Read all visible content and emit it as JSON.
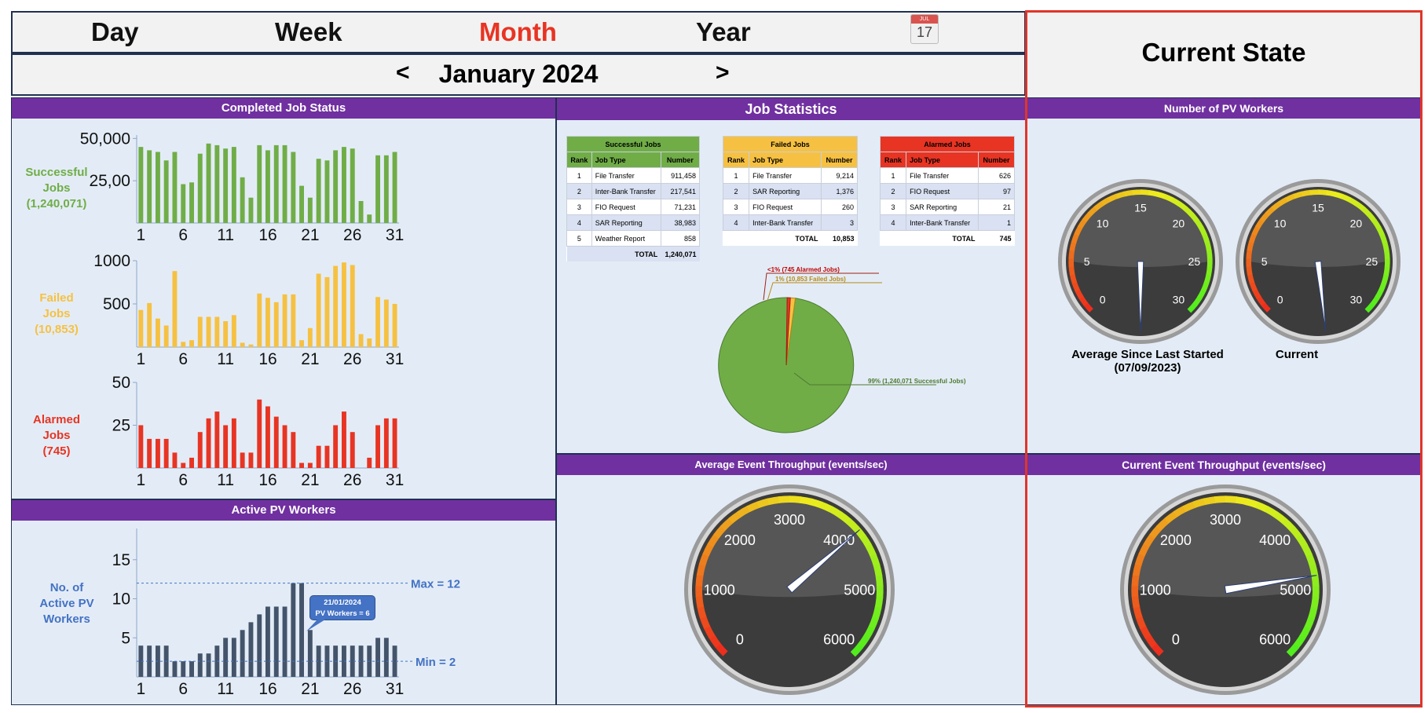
{
  "tabs": {
    "day": "Day",
    "week": "Week",
    "month": "Month",
    "year": "Year"
  },
  "calendar_icon": {
    "month": "JUL",
    "day": "17"
  },
  "period": {
    "prev": "<",
    "label": "January 2024",
    "next": ">"
  },
  "current_state": {
    "title": "Current State"
  },
  "completed": {
    "title": "Completed Job Status",
    "successful": {
      "l1": "Successful",
      "l2": "Jobs",
      "l3": "(1,240,071)"
    },
    "failed": {
      "l1": "Failed",
      "l2": "Jobs",
      "l3": "(10,853)"
    },
    "alarmed": {
      "l1": "Alarmed",
      "l2": "Jobs",
      "l3": "(745)"
    }
  },
  "active": {
    "title": "Active PV Workers",
    "ylabel": {
      "l1": "No. of",
      "l2": "Active PV",
      "l3": "Workers"
    },
    "max_label": "Max = 12",
    "min_label": "Min = 2",
    "tooltip": {
      "l1": "21/01/2024",
      "l2": "PV Workers = 6"
    }
  },
  "stats": {
    "title": "Job Statistics",
    "headers": {
      "rank": "Rank",
      "type": "Job Type",
      "number": "Number"
    },
    "successful": {
      "title": "Successful Jobs",
      "rows": [
        [
          "1",
          "File Transfer",
          "911,458"
        ],
        [
          "2",
          "Inter-Bank Transfer",
          "217,541"
        ],
        [
          "3",
          "FIO Request",
          "71,231"
        ],
        [
          "4",
          "SAR Reporting",
          "38,983"
        ],
        [
          "5",
          "Weather Report",
          "858"
        ]
      ],
      "total_label": "TOTAL",
      "total": "1,240,071"
    },
    "failed": {
      "title": "Failed Jobs",
      "rows": [
        [
          "1",
          "File Transfer",
          "9,214"
        ],
        [
          "2",
          "SAR Reporting",
          "1,376"
        ],
        [
          "3",
          "FIO Request",
          "260"
        ],
        [
          "4",
          "Inter-Bank Transfer",
          "3"
        ]
      ],
      "total_label": "TOTAL",
      "total": "10,853"
    },
    "alarmed": {
      "title": "Alarmed Jobs",
      "rows": [
        [
          "1",
          "File Transfer",
          "626"
        ],
        [
          "2",
          "FIO Request",
          "97"
        ],
        [
          "3",
          "SAR Reporting",
          "21"
        ],
        [
          "4",
          "Inter-Bank Transfer",
          "1"
        ]
      ],
      "total_label": "TOTAL",
      "total": "745"
    },
    "pie": {
      "alarmed": "<1% (745 Alarmed Jobs)",
      "failed": "1% (10,853 Failed Jobs)",
      "successful": "99% (1,240,071 Successful Jobs)"
    }
  },
  "workers": {
    "title": "Number of PV Workers",
    "avg_l1": "Average Since Last Started",
    "avg_l2": "(07/09/2023)",
    "current": "Current"
  },
  "avg_tp": {
    "title": "Average Event Throughput  (events/sec)"
  },
  "cur_tp": {
    "title": "Current Event Throughput (events/sec)"
  },
  "colors": {
    "purple": "#7030a0",
    "green": "#70ad47",
    "yellow": "#f6c142",
    "red": "#e83423",
    "navy": "#44546a",
    "blue": "#4472c4",
    "active_tab": "#e83423"
  },
  "chart_data": [
    {
      "type": "bar",
      "name": "successful",
      "x": [
        1,
        2,
        3,
        4,
        5,
        6,
        7,
        8,
        9,
        10,
        11,
        12,
        13,
        14,
        15,
        16,
        17,
        18,
        19,
        20,
        21,
        22,
        23,
        24,
        25,
        26,
        27,
        28,
        29,
        30,
        31
      ],
      "values": [
        45000,
        43000,
        42000,
        37000,
        42000,
        23000,
        24000,
        41000,
        47000,
        46000,
        44000,
        45000,
        27000,
        15000,
        46000,
        43000,
        46000,
        46000,
        42000,
        22000,
        15000,
        38000,
        37000,
        43000,
        45000,
        44000,
        13000,
        5000,
        40000,
        40000,
        42000
      ],
      "ylim": [
        0,
        52000
      ],
      "yticks": [
        "50,000",
        "25,00"
      ],
      "xticks": [
        "1",
        "6",
        "11",
        "16",
        "21",
        "26",
        "31"
      ]
    },
    {
      "type": "bar",
      "name": "failed",
      "x": [
        1,
        2,
        3,
        4,
        5,
        6,
        7,
        8,
        9,
        10,
        11,
        12,
        13,
        14,
        15,
        16,
        17,
        18,
        19,
        20,
        21,
        22,
        23,
        24,
        25,
        26,
        27,
        28,
        29,
        30,
        31
      ],
      "values": [
        430,
        510,
        330,
        250,
        880,
        60,
        80,
        350,
        350,
        350,
        300,
        370,
        50,
        30,
        620,
        570,
        520,
        610,
        610,
        80,
        220,
        850,
        810,
        940,
        980,
        950,
        150,
        100,
        580,
        550,
        500
      ],
      "ylim": [
        0,
        1000
      ],
      "yticks": [
        "1000",
        "500"
      ],
      "xticks": [
        "1",
        "6",
        "11",
        "16",
        "21",
        "26",
        "31"
      ]
    },
    {
      "type": "bar",
      "name": "alarmed",
      "x": [
        1,
        2,
        3,
        4,
        5,
        6,
        7,
        8,
        9,
        10,
        11,
        12,
        13,
        14,
        15,
        16,
        17,
        18,
        19,
        20,
        21,
        22,
        23,
        24,
        25,
        26,
        27,
        28,
        29,
        30,
        31
      ],
      "values": [
        25,
        17,
        17,
        17,
        9,
        3,
        6,
        21,
        29,
        33,
        25,
        29,
        9,
        9,
        40,
        36,
        30,
        25,
        21,
        3,
        3,
        13,
        13,
        25,
        33,
        21,
        0,
        6,
        25,
        29,
        29
      ],
      "ylim": [
        0,
        50
      ],
      "yticks": [
        "50",
        "25"
      ],
      "xticks": [
        "1",
        "6",
        "11",
        "16",
        "21",
        "26",
        "31"
      ]
    },
    {
      "type": "bar",
      "name": "active_pv_workers",
      "x": [
        1,
        2,
        3,
        4,
        5,
        6,
        7,
        8,
        9,
        10,
        11,
        12,
        13,
        14,
        15,
        16,
        17,
        18,
        19,
        20,
        21,
        22,
        23,
        24,
        25,
        26,
        27,
        28,
        29,
        30,
        31
      ],
      "values": [
        4,
        4,
        4,
        4,
        2,
        2,
        2,
        3,
        3,
        4,
        5,
        5,
        6,
        7,
        8,
        9,
        9,
        9,
        12,
        12,
        6,
        4,
        4,
        4,
        4,
        4,
        4,
        4,
        5,
        5,
        4
      ],
      "ylim": [
        0,
        19
      ],
      "yticks": [
        "15",
        "10",
        "5"
      ],
      "xticks": [
        "1",
        "6",
        "11",
        "16",
        "21",
        "26",
        "31"
      ],
      "max": 12,
      "min": 2
    },
    {
      "type": "pie",
      "name": "job_share",
      "values": [
        1240071,
        10853,
        745
      ],
      "categories": [
        "Successful",
        "Failed",
        "Alarmed"
      ]
    }
  ],
  "gauges": [
    {
      "name": "avg-workers",
      "min": 0,
      "max": 30,
      "ticks": [
        "0",
        "5",
        "10",
        "15",
        "20",
        "25",
        "30"
      ],
      "value": -5
    },
    {
      "name": "current-workers",
      "min": 0,
      "max": 30,
      "ticks": [
        "0",
        "5",
        "10",
        "15",
        "20",
        "25",
        "30"
      ],
      "value": -5.7
    },
    {
      "name": "avg-throughput",
      "min": 0,
      "max": 6000,
      "ticks": [
        "0",
        "1000",
        "2000",
        "3000",
        "4000",
        "5000",
        "6000"
      ],
      "value": 4100
    },
    {
      "name": "current-throughput",
      "min": 0,
      "max": 6000,
      "ticks": [
        "0",
        "1000",
        "2000",
        "3000",
        "4000",
        "5000",
        "6000"
      ],
      "value": 4800
    }
  ]
}
